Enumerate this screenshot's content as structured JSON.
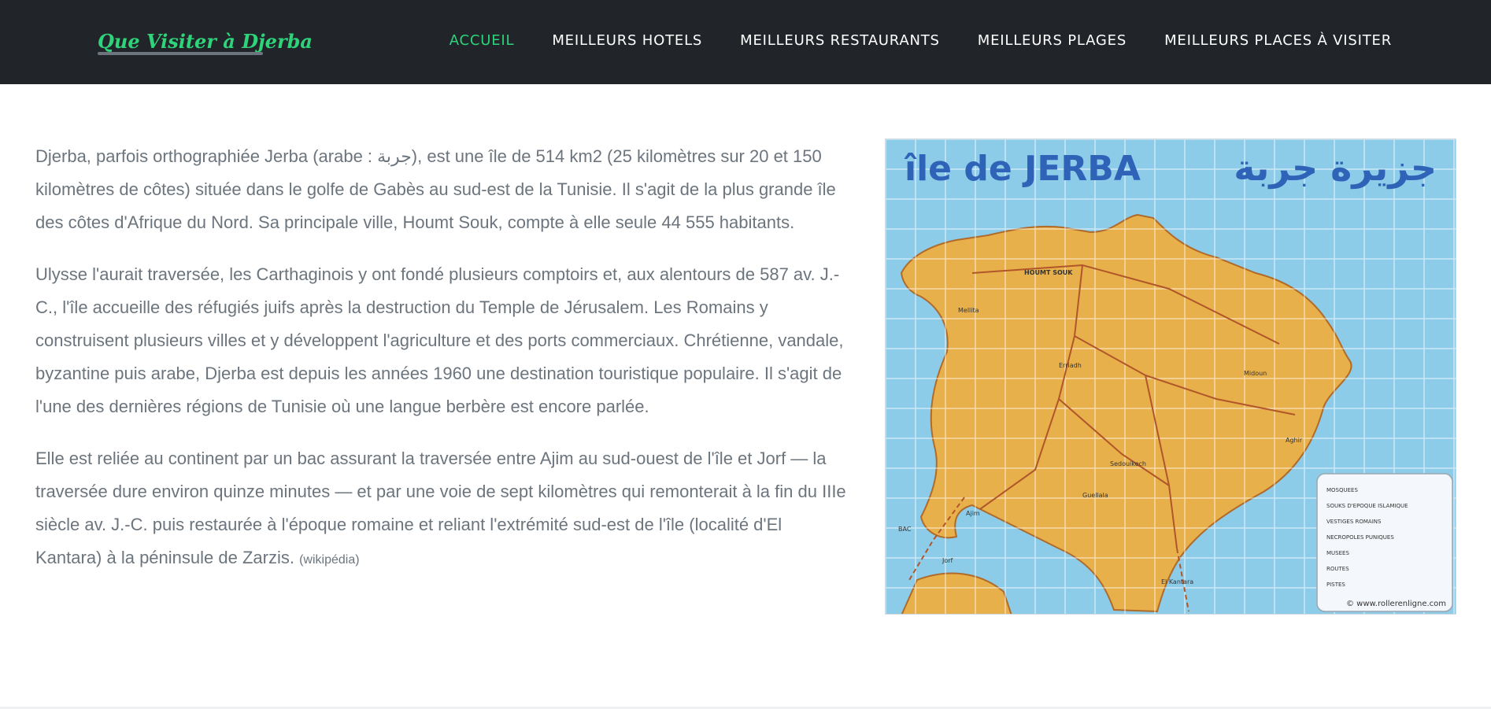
{
  "brand": "Que Visiter à Djerba",
  "nav": {
    "items": [
      {
        "label": "ACCUEIL",
        "active": true
      },
      {
        "label": "MEILLEURS HOTELS",
        "active": false
      },
      {
        "label": "MEILLEURS RESTAURANTS",
        "active": false
      },
      {
        "label": "MEILLEURS PLAGES",
        "active": false
      },
      {
        "label": "MEILLEURS PLACES À VISITER",
        "active": false
      }
    ]
  },
  "content": {
    "paragraphs": [
      "Djerba, parfois orthographiée Jerba (arabe : جربة), est une île de 514 km2 (25 kilomètres sur 20 et 150 kilomètres de côtes) située dans le golfe de Gabès au sud-est de la Tunisie. Il s'agit de la plus grande île des côtes d'Afrique du Nord. Sa principale ville, Houmt Souk, compte à elle seule 44 555 habitants.",
      "Ulysse l'aurait traversée, les Carthaginois y ont fondé plusieurs comptoirs et, aux alentours de 587 av. J.-C., l'île accueille des réfugiés juifs après la destruction du Temple de Jérusalem. Les Romains y construisent plusieurs villes et y développent l'agriculture et des ports commerciaux. Chrétienne, vandale, byzantine puis arabe, Djerba est depuis les années 1960 une destination touristique populaire. Il s'agit de l'une des dernières régions de Tunisie où une langue berbère est encore parlée.",
      "Elle est reliée au continent par un bac assurant la traversée entre Ajim au sud-ouest de l'île et Jorf — la traversée dure environ quinze minutes — et par une voie de sept kilomètres qui remonterait à la fin du IIIe siècle av. J.-C. puis restaurée à l'époque romaine et reliant l'extrémité sud-est de l'île (localité d'El Kantara) à la péninsule de Zarzis."
    ],
    "source": "(wikipédia)"
  },
  "map": {
    "title": "île de JERBA",
    "title_arabic": "جزيرة جربة",
    "credit": "© www.rollerenligne.com",
    "places": [
      "HOUMT SOUK",
      "Midoun",
      "Ajim",
      "Guellala",
      "El Kantara",
      "Aghir",
      "Mellita",
      "Erriadh",
      "Sedouikech",
      "Jorf",
      "BAC"
    ],
    "legend": [
      "MOSQUEES",
      "SOUKS D'EPOQUE ISLAMIQUE",
      "VESTIGES ROMAINS",
      "NECROPOLES PUNIQUES",
      "MUSEES",
      "ROUTES",
      "PISTES"
    ]
  },
  "colors": {
    "navbar_bg": "#212529",
    "accent": "#2ed37a",
    "text": "#6c757d",
    "sea": "#8ccce8",
    "land": "#e8b04a"
  }
}
